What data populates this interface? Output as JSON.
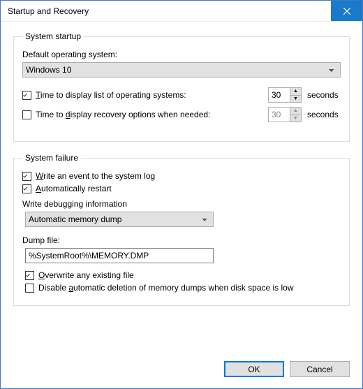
{
  "window": {
    "title": "Startup and Recovery",
    "close_icon": "close-icon"
  },
  "startup": {
    "legend": "System startup",
    "default_os_label": "Default operating system:",
    "default_os_value": "Windows 10",
    "display_os_list": {
      "checked": true,
      "label_pre": "T",
      "label_rest": "ime to display list of operating systems:",
      "value": "30",
      "unit": "seconds"
    },
    "display_recovery": {
      "checked": false,
      "label_pre": "Time to ",
      "label_u": "d",
      "label_rest": "isplay recovery options when needed:",
      "value": "30",
      "unit": "seconds"
    }
  },
  "failure": {
    "legend": "System failure",
    "write_event": {
      "checked": true,
      "pre": "W",
      "rest": "rite an event to the system log"
    },
    "auto_restart": {
      "checked": true,
      "pre": "A",
      "rest": "utomatically restart"
    },
    "debug_label": "Write debugging information",
    "debug_value": "Automatic memory dump",
    "dump_label": "Dump file:",
    "dump_value": "%SystemRoot%\\MEMORY.DMP",
    "overwrite": {
      "checked": true,
      "pre": "O",
      "rest": "verwrite any existing file"
    },
    "disable_delete": {
      "checked": false,
      "pre": "Disable ",
      "u": "a",
      "rest": "utomatic deletion of memory dumps when disk space is low"
    }
  },
  "buttons": {
    "ok": "OK",
    "cancel": "Cancel"
  }
}
